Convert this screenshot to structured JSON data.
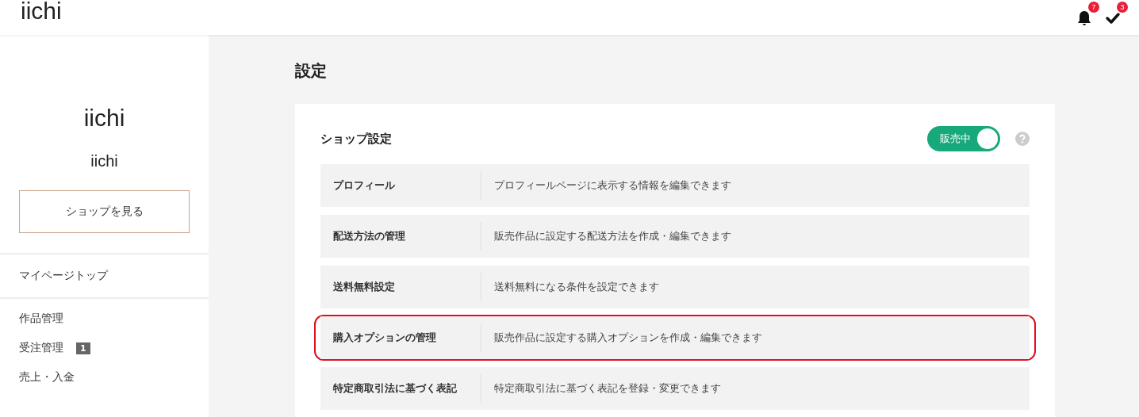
{
  "header": {
    "logo": "iichi",
    "notifications": {
      "badge": "7"
    },
    "tasks": {
      "badge": "3"
    }
  },
  "sidebar": {
    "shop_name": "iichi",
    "user_name": "iichi",
    "view_shop_button": "ショップを見る",
    "top_link": "マイページトップ",
    "items": [
      {
        "label": "作品管理"
      },
      {
        "label": "受注管理",
        "badge": "1"
      },
      {
        "label": "売上・入金"
      }
    ]
  },
  "page": {
    "title": "設定",
    "section": {
      "title": "ショップ設定",
      "toggle": {
        "label": "販売中",
        "on": true
      },
      "rows": [
        {
          "label": "プロフィール",
          "description": "プロフィールページに表示する情報を編集できます",
          "highlighted": false
        },
        {
          "label": "配送方法の管理",
          "description": "販売作品に設定する配送方法を作成・編集できます",
          "highlighted": false
        },
        {
          "label": "送料無料設定",
          "description": "送料無料になる条件を設定できます",
          "highlighted": false
        },
        {
          "label": "購入オプションの管理",
          "description": "販売作品に設定する購入オプションを作成・編集できます",
          "highlighted": true
        },
        {
          "label": "特定商取引法に基づく表記",
          "description": "特定商取引法に基づく表記を登録・変更できます",
          "highlighted": false
        }
      ]
    }
  }
}
